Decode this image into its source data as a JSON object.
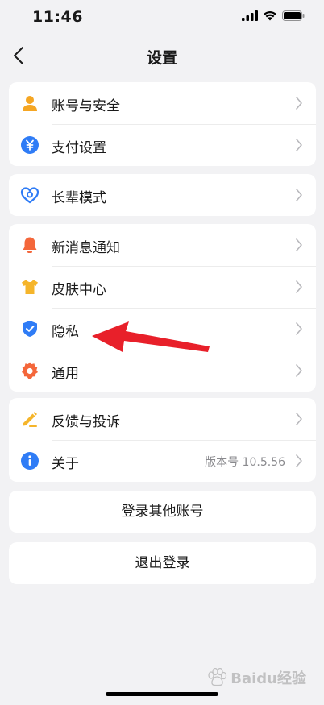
{
  "status": {
    "time": "11:46"
  },
  "nav": {
    "title": "设置"
  },
  "groups": [
    {
      "items": [
        {
          "label": "账号与安全",
          "icon": "user-icon",
          "color": "#f5a623"
        },
        {
          "label": "支付设置",
          "icon": "yuan-icon",
          "color": "#2f7cf6"
        }
      ]
    },
    {
      "items": [
        {
          "label": "长辈模式",
          "icon": "heart-icon",
          "color": "#2f7cf6"
        }
      ]
    },
    {
      "items": [
        {
          "label": "新消息通知",
          "icon": "bell-icon",
          "color": "#f4673b"
        },
        {
          "label": "皮肤中心",
          "icon": "shirt-icon",
          "color": "#f5b52b"
        },
        {
          "label": "隐私",
          "icon": "shield-icon",
          "color": "#2f7cf6"
        },
        {
          "label": "通用",
          "icon": "gear-icon",
          "color": "#f4673b"
        }
      ]
    },
    {
      "items": [
        {
          "label": "反馈与投诉",
          "icon": "pencil-icon",
          "color": "#f5b52b"
        },
        {
          "label": "关于",
          "icon": "info-icon",
          "color": "#2f7cf6",
          "value": "版本号 10.5.56"
        }
      ]
    }
  ],
  "actions": {
    "login_other": "登录其他账号",
    "logout": "退出登录"
  },
  "watermark": {
    "text": "Baidu经验"
  },
  "colors": {
    "background": "#f2f2f4",
    "arrow": "#e8202a"
  }
}
